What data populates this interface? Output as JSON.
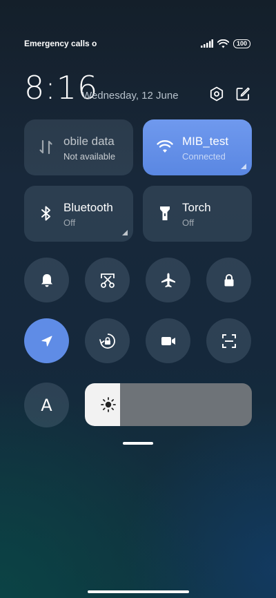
{
  "status_bar": {
    "carrier_text": "Emergency calls o",
    "battery": "100"
  },
  "header": {
    "time": "8:16",
    "date": "Wednesday, 12 June"
  },
  "tiles": [
    {
      "label": "obile data",
      "status": "Not available",
      "icon": "mobile-data-icon",
      "active": false
    },
    {
      "label": "MIB_test",
      "status": "Connected",
      "icon": "wifi-icon",
      "active": true
    },
    {
      "label": "Bluetooth",
      "status": "Off",
      "icon": "bluetooth-icon",
      "active": false
    },
    {
      "label": "Torch",
      "status": "Off",
      "icon": "torch-icon",
      "active": false
    }
  ],
  "toggles": [
    {
      "name": "silent",
      "icon": "bell-icon",
      "active": false
    },
    {
      "name": "screenshot",
      "icon": "scissors-icon",
      "active": false
    },
    {
      "name": "airplane",
      "icon": "airplane-icon",
      "active": false
    },
    {
      "name": "lock",
      "icon": "lock-icon",
      "active": false
    },
    {
      "name": "location",
      "icon": "location-arrow-icon",
      "active": true
    },
    {
      "name": "rotation-lock",
      "icon": "rotation-lock-icon",
      "active": false
    },
    {
      "name": "screen-recorder",
      "icon": "video-camera-icon",
      "active": false
    },
    {
      "name": "scanner",
      "icon": "scan-icon",
      "active": false
    }
  ],
  "auto_brightness_label": "A",
  "brightness": {
    "level": 0.21
  },
  "colors": {
    "accent": "#5f8ce6",
    "tile_bg": "#2c3a48"
  }
}
